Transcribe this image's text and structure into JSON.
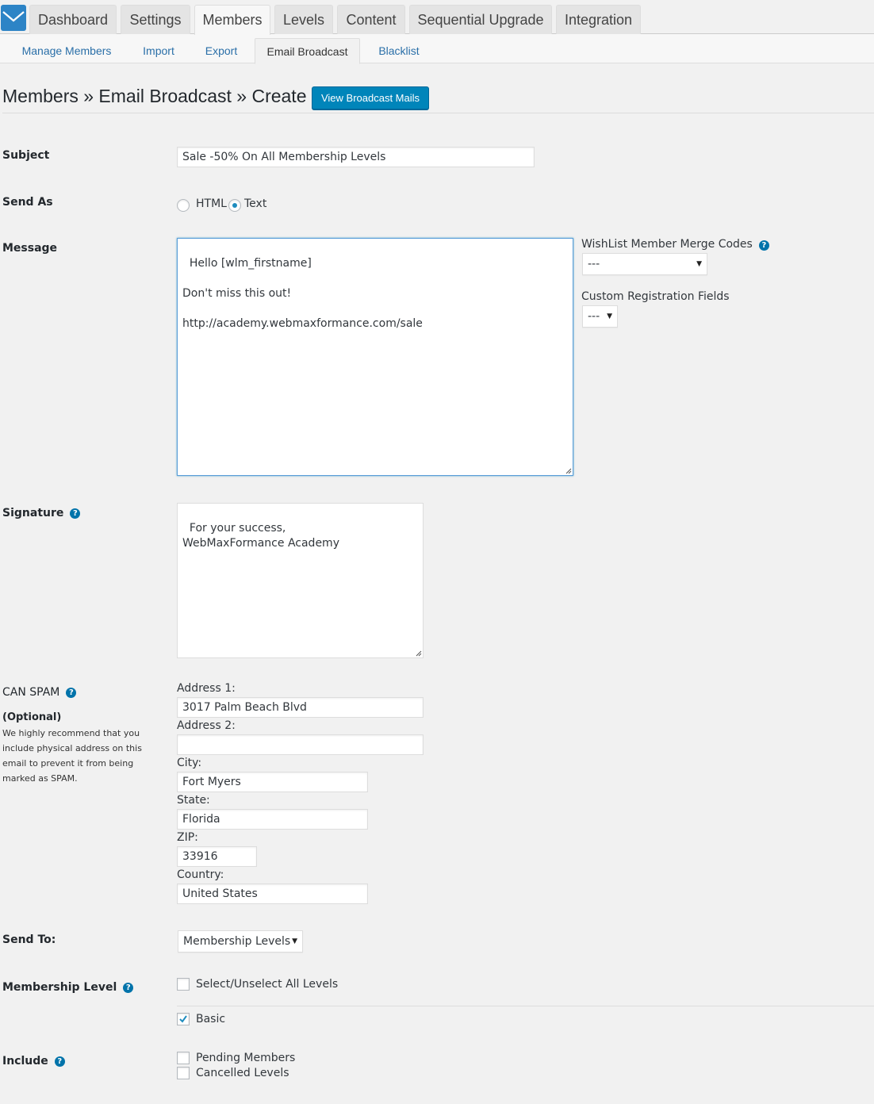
{
  "top_tabs": [
    {
      "label": "Dashboard",
      "active": false
    },
    {
      "label": "Settings",
      "active": false
    },
    {
      "label": "Members",
      "active": true
    },
    {
      "label": "Levels",
      "active": false
    },
    {
      "label": "Content",
      "active": false
    },
    {
      "label": "Sequential Upgrade",
      "active": false
    },
    {
      "label": "Integration",
      "active": false
    }
  ],
  "sub_tabs": [
    {
      "label": "Manage Members",
      "active": false
    },
    {
      "label": "Import",
      "active": false
    },
    {
      "label": "Export",
      "active": false
    },
    {
      "label": "Email Broadcast",
      "active": true
    },
    {
      "label": "Blacklist",
      "active": false
    }
  ],
  "header": {
    "title": "Members » Email Broadcast » Create",
    "view_button": "View Broadcast Mails"
  },
  "colors": {
    "accent": "#0085ba",
    "logo": "#2d84c6",
    "help_icon": "#0073aa"
  },
  "form": {
    "subject": {
      "label": "Subject",
      "value": "Sale -50% On All Membership Levels"
    },
    "send_as": {
      "label": "Send As",
      "options": [
        "HTML",
        "Text"
      ],
      "selected": "Text"
    },
    "message": {
      "label": "Message",
      "value": "Hello [wlm_firstname]\n\nDon't miss this out!\n\nhttp://academy.webmaxformance.com/sale"
    },
    "merge_codes": {
      "label": "WishList Member Merge Codes",
      "value": "---"
    },
    "custom_fields": {
      "label": "Custom Registration Fields",
      "value": "---"
    },
    "signature": {
      "label": "Signature",
      "value": "For your success,\nWebMaxFormance Academy"
    },
    "can_spam": {
      "label": "CAN SPAM",
      "optional": "(Optional)",
      "note": "We highly recommend that you include physical address on this email to prevent it from being marked as SPAM.",
      "address1": {
        "label": "Address 1:",
        "value": "3017 Palm Beach Blvd"
      },
      "address2": {
        "label": "Address 2:",
        "value": ""
      },
      "city": {
        "label": "City:",
        "value": "Fort Myers"
      },
      "state": {
        "label": "State:",
        "value": "Florida"
      },
      "zip": {
        "label": "ZIP:",
        "value": "33916"
      },
      "country": {
        "label": "Country:",
        "value": "United States"
      }
    },
    "send_to": {
      "label": "Send To:",
      "value": "Membership Levels"
    },
    "membership_level": {
      "label": "Membership Level",
      "select_all": {
        "label": "Select/Unselect All Levels",
        "checked": false
      },
      "levels": [
        {
          "label": "Basic",
          "checked": true
        }
      ]
    },
    "include": {
      "label": "Include",
      "options": [
        {
          "label": "Pending Members",
          "checked": false
        },
        {
          "label": "Cancelled Levels",
          "checked": false
        }
      ]
    }
  }
}
